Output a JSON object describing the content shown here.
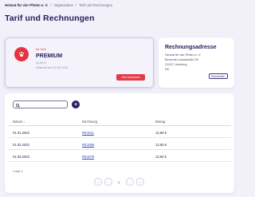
{
  "breadcrumb": [
    "Heimat für vier Pfoten e. V.",
    "Organisation",
    "Tarif und Rechnungen"
  ],
  "page_title": "Tarif und Rechnungen",
  "plan": {
    "label": "Ihr Tarif",
    "name": "PREMIUM",
    "price": "12,50 €",
    "since": "Gebucht am 01.09.2021",
    "upgrade_button": "Jetzt wechseln"
  },
  "address": {
    "title": "Rechnungsadresse",
    "lines": [
      "Heimat für vier Pfoten e. V.",
      "Beckeder Landstraße 28",
      "21337 Lüneburg",
      "DE"
    ],
    "edit_button": "Bearbeiten"
  },
  "table": {
    "search_placeholder": "",
    "columns": [
      "Datum",
      "Rechnung",
      "Betrag"
    ],
    "rows": [
      {
        "date": "01.01.2022",
        "invoice": "RE1011",
        "amount": "12,50 €"
      },
      {
        "date": "01.02.2022",
        "invoice": "RE1056",
        "amount": "12,50 €"
      },
      {
        "date": "01.03.2022",
        "invoice": "RE1079",
        "amount": "12,50 €"
      }
    ],
    "count": "1 von 1",
    "page": "1"
  },
  "colors": {
    "accent": "#e23a46",
    "primary": "#23215e",
    "link": "#2f48b8",
    "background": "#f2f1f9"
  }
}
